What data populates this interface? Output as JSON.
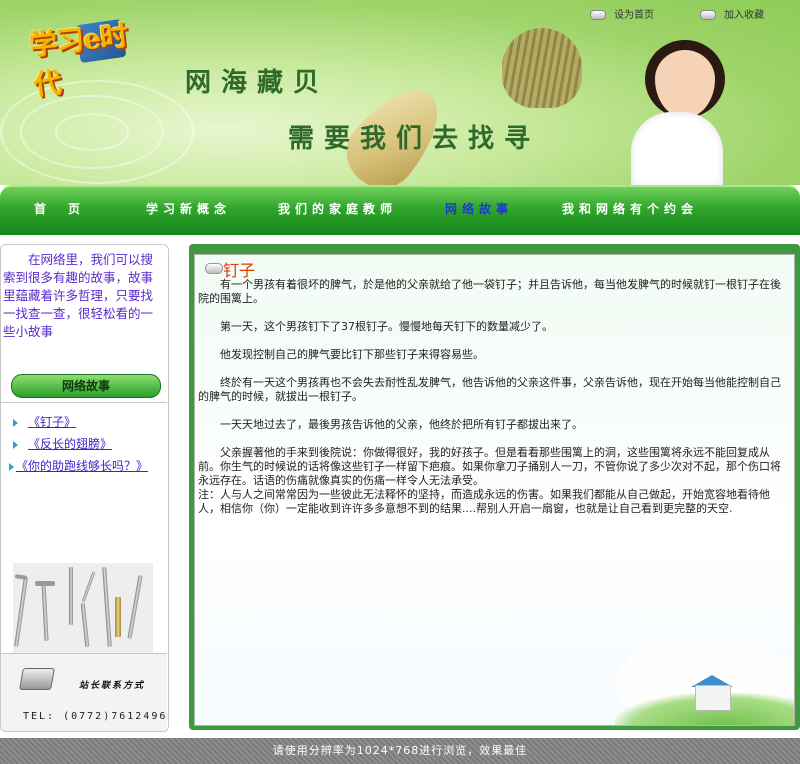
{
  "header": {
    "logo_text": "学习e时代",
    "headline_1": "网海藏贝",
    "headline_2": "需要我们去找寻",
    "top_links": [
      {
        "label": "设为首页"
      },
      {
        "label": "加入收藏"
      }
    ]
  },
  "nav": {
    "items": [
      {
        "label": "首　页",
        "active": false
      },
      {
        "label": "学习新概念",
        "active": false
      },
      {
        "label": "我们的家庭教师",
        "active": false
      },
      {
        "label": "网络故事",
        "active": true
      },
      {
        "label": "我和网络有个约会",
        "active": false
      }
    ]
  },
  "sidebar": {
    "intro": "在网络里，我们可以搜索到很多有趣的故事，故事里蕴藏着许多哲理，只要找一找查一查，很轻松看的一些小故事",
    "section_title": "网络故事",
    "stories": [
      {
        "label": "《钉子》"
      },
      {
        "label": "《反长的翅膀》"
      },
      {
        "label": "《你的助跑线够长吗？》"
      }
    ],
    "contact_title": "站长联系方式",
    "contact_tel": "TEL: (0772)7612496"
  },
  "article": {
    "title": "钉子",
    "paragraphs": [
      "有一个男孩有着很坏的脾气，於是他的父亲就给了他一袋钉子；并且告诉他，每当他发脾气的时候就钉一根钉子在後院的围篱上。",
      "第一天，这个男孩钉下了37根钉子。慢慢地每天钉下的数量减少了。",
      "他发现控制自己的脾气要比钉下那些钉子来得容易些。",
      "终於有一天这个男孩再也不会失去耐性乱发脾气，他告诉他的父亲这件事，父亲告诉他，现在开始每当他能控制自己的脾气的时候，就拔出一根钉子。",
      "一天天地过去了，最後男孩告诉他的父亲，他终於把所有钉子都拔出来了。",
      "父亲握著他的手来到後院说：你做得很好，我的好孩子。但是看看那些围篱上的洞，这些围篱将永远不能回复成从前。你生气的时候说的话将像这些钉子一样留下疤痕。如果你拿刀子捅别人一刀，不管你说了多少次对不起，那个伤口将永远存在。话语的伤痛就像真实的伤痛一样令人无法承受。"
    ],
    "note": "注：人与人之间常常因为一些彼此无法释怀的坚持，而造成永远的伤害。如果我们都能从自己做起，开始宽容地看待他人，相信你（你）一定能收到许许多多意想不到的结果....帮别人开启一扇窗，也就是让自己看到更完整的天空."
  },
  "footer": {
    "text": "请使用分辨率为1024*768进行浏览，效果最佳"
  }
}
